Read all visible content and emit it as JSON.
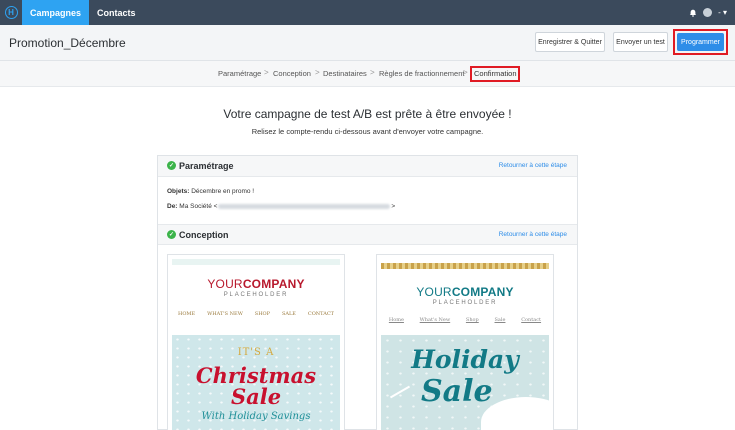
{
  "nav": {
    "tabs": [
      {
        "label": "Campagnes",
        "active": true
      },
      {
        "label": "Contacts",
        "active": false
      }
    ],
    "logo_icon": "h-logo-icon",
    "bell_icon": "bell-icon",
    "account_caret": "- ▾"
  },
  "header": {
    "title": "Promotion_Décembre",
    "buttons": {
      "save_quit": "Enregistrer & Quitter",
      "send_test": "Envoyer un test",
      "schedule": "Programmer"
    }
  },
  "breadcrumb": {
    "steps": [
      "Paramétrage",
      "Conception",
      "Destinataires",
      "Règles de fractionnement",
      "Confirmation"
    ],
    "separator": ">",
    "active": "Confirmation"
  },
  "main": {
    "headline": "Votre campagne de test A/B est prête à être envoyée !",
    "subline": "Relisez le compte-rendu ci-dessous avant d'envoyer votre campagne."
  },
  "summary": {
    "settings": {
      "title": "Paramétrage",
      "link": "Retourner à cette étape",
      "subject_label": "Objets:",
      "subject_value": "Décembre en promo !",
      "from_label": "De:",
      "from_value": "Ma Société <",
      "from_end": ">"
    },
    "design": {
      "title": "Conception",
      "link": "Retourner à cette étape"
    }
  },
  "preview_a": {
    "brand_light": "YOUR",
    "brand_bold": "COMPANY",
    "placeholder": "PLACEHOLDER",
    "menu": [
      "HOME",
      "WHAT'S NEW",
      "SHOP",
      "SALE",
      "CONTACT"
    ],
    "hero_top": "IT'S A",
    "hero_main": "Christmas Sale",
    "hero_bottom": "With Holiday Savings"
  },
  "preview_b": {
    "brand_light": "YOUR",
    "brand_bold": "COMPANY",
    "placeholder": "PLACEHOLDER",
    "menu": [
      "Home",
      "What's New",
      "Shop",
      "Sale",
      "Contact"
    ],
    "hero_top": "Holiday",
    "hero_main": "Sale"
  },
  "colors": {
    "nav_bg": "#3b4a5c",
    "accent_blue": "#2e8de8",
    "highlight_red": "#e01b24",
    "success_green": "#3cb44a",
    "brand_red": "#b8192d",
    "brand_teal": "#127a86"
  }
}
